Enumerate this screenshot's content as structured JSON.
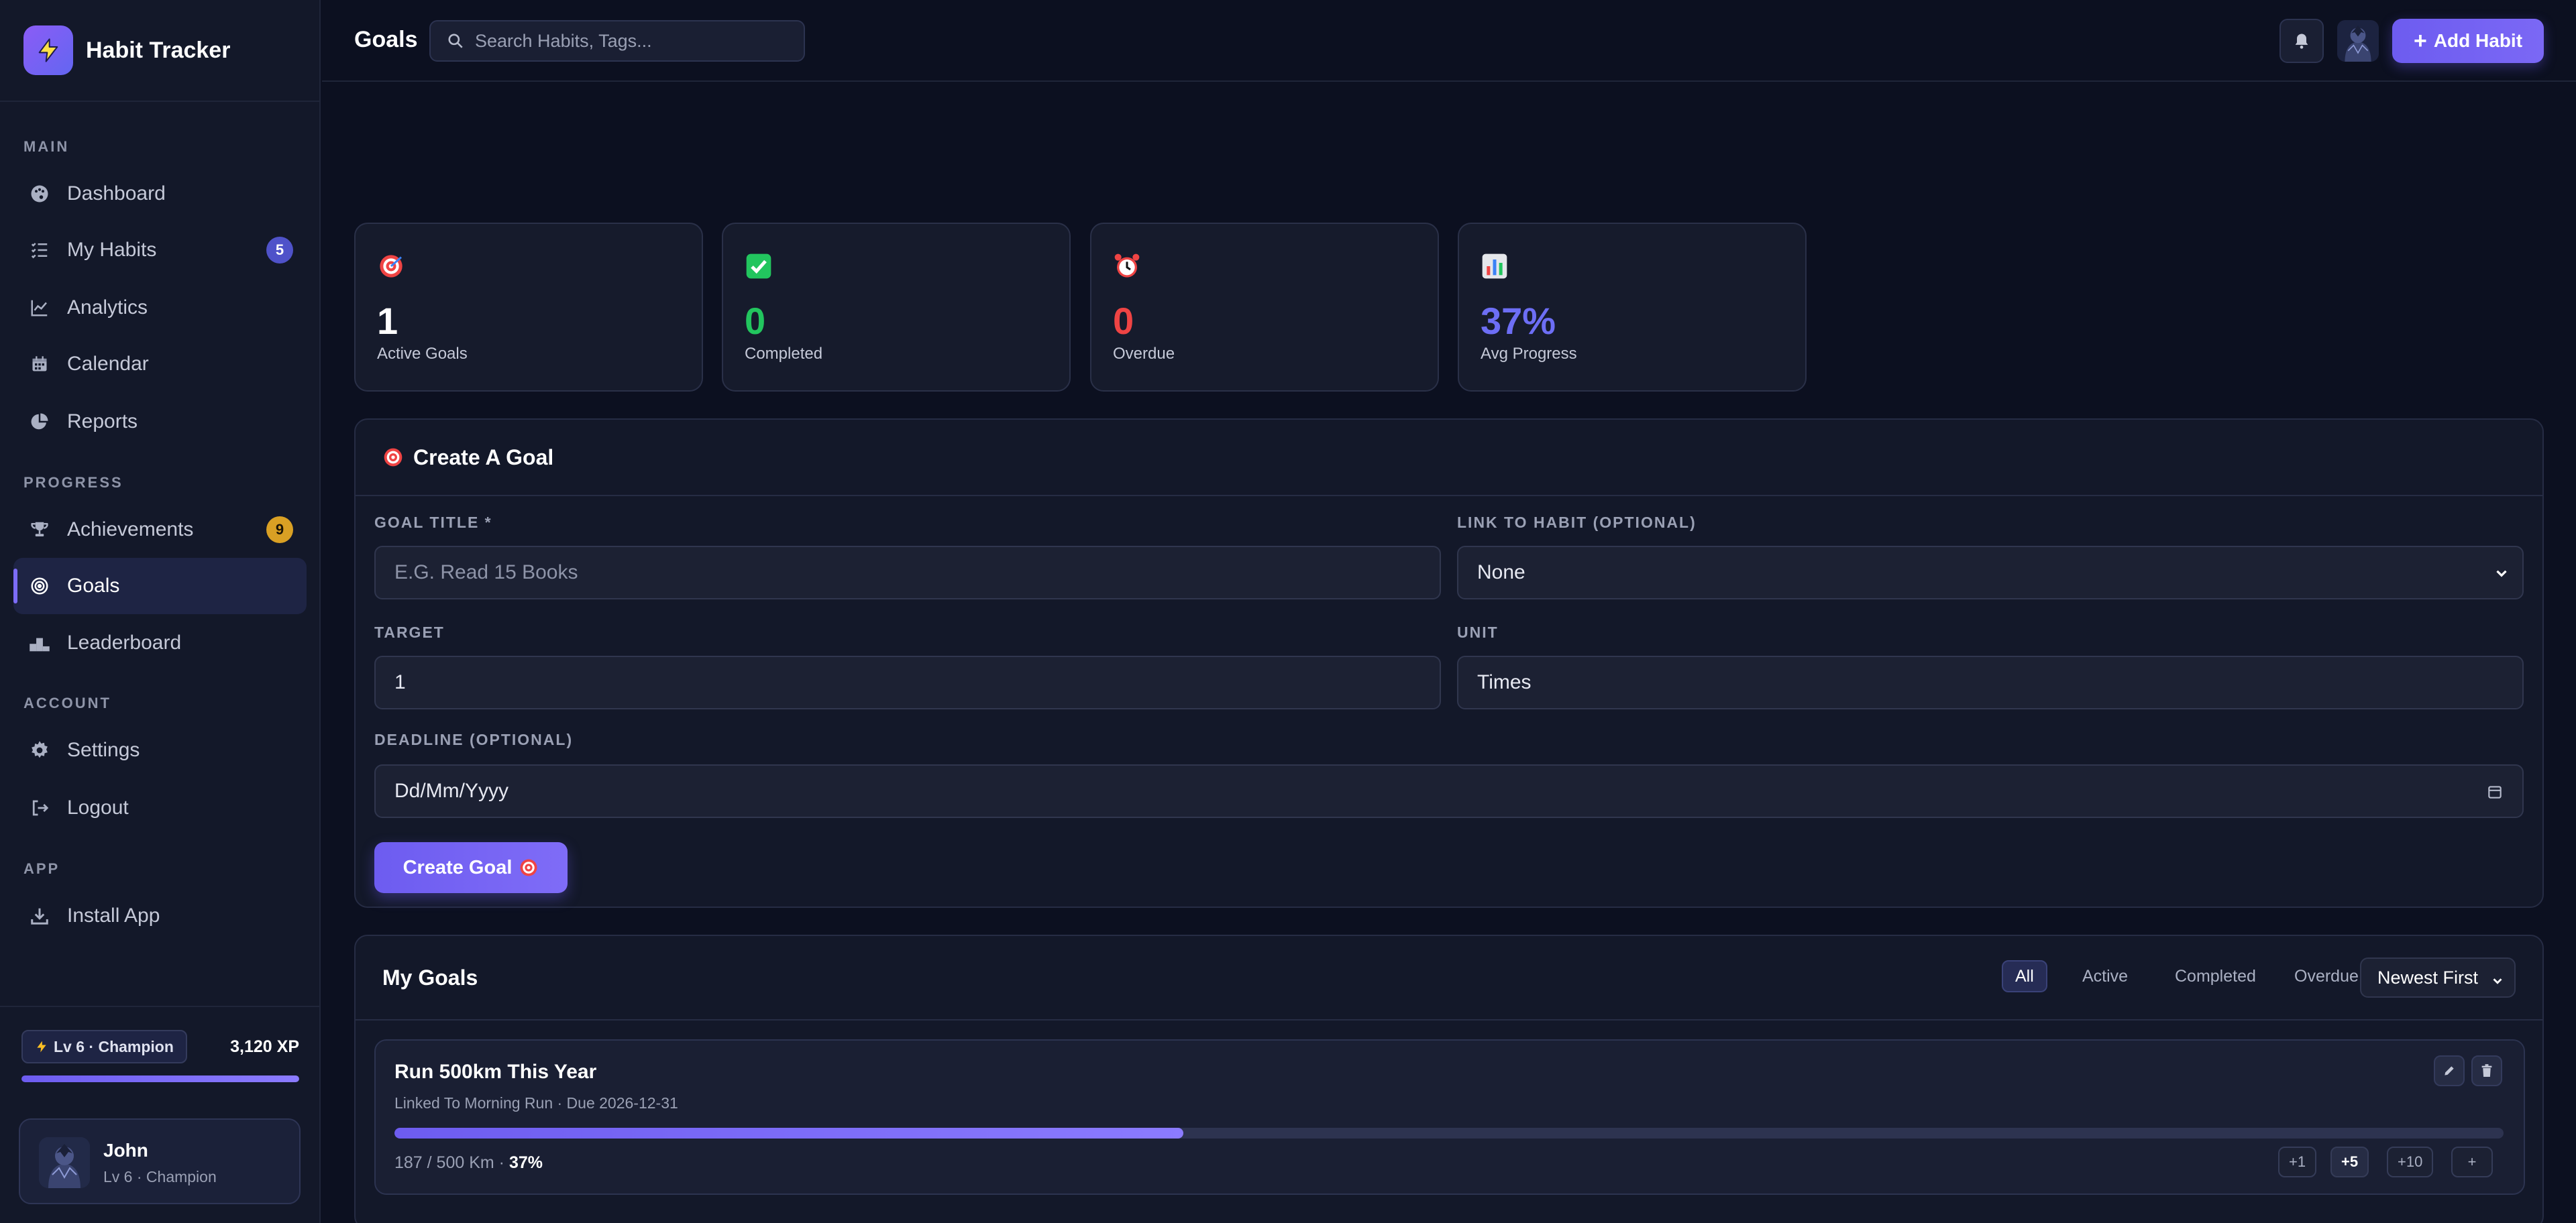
{
  "app": {
    "title": "Habit Tracker",
    "accent": "#6d5cf0"
  },
  "sidebar": {
    "sections": {
      "main": "MAIN",
      "progress": "PROGRESS",
      "account": "ACCOUNT",
      "app": "APP"
    },
    "items": [
      {
        "label": "Dashboard",
        "icon": "palette-icon"
      },
      {
        "label": "My Habits",
        "icon": "list-check-icon",
        "badge": "5"
      },
      {
        "label": "Analytics",
        "icon": "line-chart-icon"
      },
      {
        "label": "Calendar",
        "icon": "calendar-icon"
      },
      {
        "label": "Reports",
        "icon": "pie-chart-icon"
      },
      {
        "label": "Achievements",
        "icon": "trophy-icon",
        "badge": "9"
      },
      {
        "label": "Goals",
        "icon": "bullseye-icon",
        "active": true
      },
      {
        "label": "Leaderboard",
        "icon": "podium-icon"
      },
      {
        "label": "Settings",
        "icon": "gear-icon"
      },
      {
        "label": "Logout",
        "icon": "logout-icon"
      },
      {
        "label": "Install App",
        "icon": "download-icon"
      }
    ],
    "level_pill": "Lv 6 · Champion",
    "xp": "3,120 XP",
    "xp_progress": 1.0,
    "user": {
      "name": "John",
      "level": "Lv 6 · Champion"
    }
  },
  "header": {
    "title": "Goals",
    "search_placeholder": "Search Habits, Tags...",
    "add_button": "Add Habit"
  },
  "stats": [
    {
      "icon": "target-emoji",
      "value": "1",
      "label": "Active Goals",
      "color": "#ffffff"
    },
    {
      "icon": "check-emoji",
      "value": "0",
      "label": "Completed",
      "color": "#22c55e"
    },
    {
      "icon": "alarm-emoji",
      "value": "0",
      "label": "Overdue",
      "color": "#ef4444"
    },
    {
      "icon": "bar-chart-emoji",
      "value": "37%",
      "label": "Avg Progress",
      "color": "#6d6ef5"
    }
  ],
  "create_goal": {
    "heading": "Create A Goal",
    "title_label": "GOAL TITLE *",
    "title_placeholder": "E.G. Read 15 Books",
    "link_label": "LINK TO HABIT (OPTIONAL)",
    "link_value": "None",
    "target_label": "TARGET",
    "target_value": "1",
    "unit_label": "UNIT",
    "unit_value": "Times",
    "deadline_label": "DEADLINE (OPTIONAL)",
    "deadline_value": "Dd/Mm/Yyyy",
    "submit": "Create Goal"
  },
  "my_goals": {
    "heading": "My Goals",
    "filters": [
      "All",
      "Active",
      "Completed",
      "Overdue"
    ],
    "active_filter": "All",
    "sort": "Newest First",
    "goals": [
      {
        "title": "Run 500km This Year",
        "meta": "Linked To Morning Run · Due 2026-12-31",
        "progress_text": "187 / 500 Km · ",
        "percent": "37%",
        "progress": 0.374,
        "increments": [
          "+1",
          "+5",
          "+10",
          "+"
        ]
      }
    ]
  }
}
